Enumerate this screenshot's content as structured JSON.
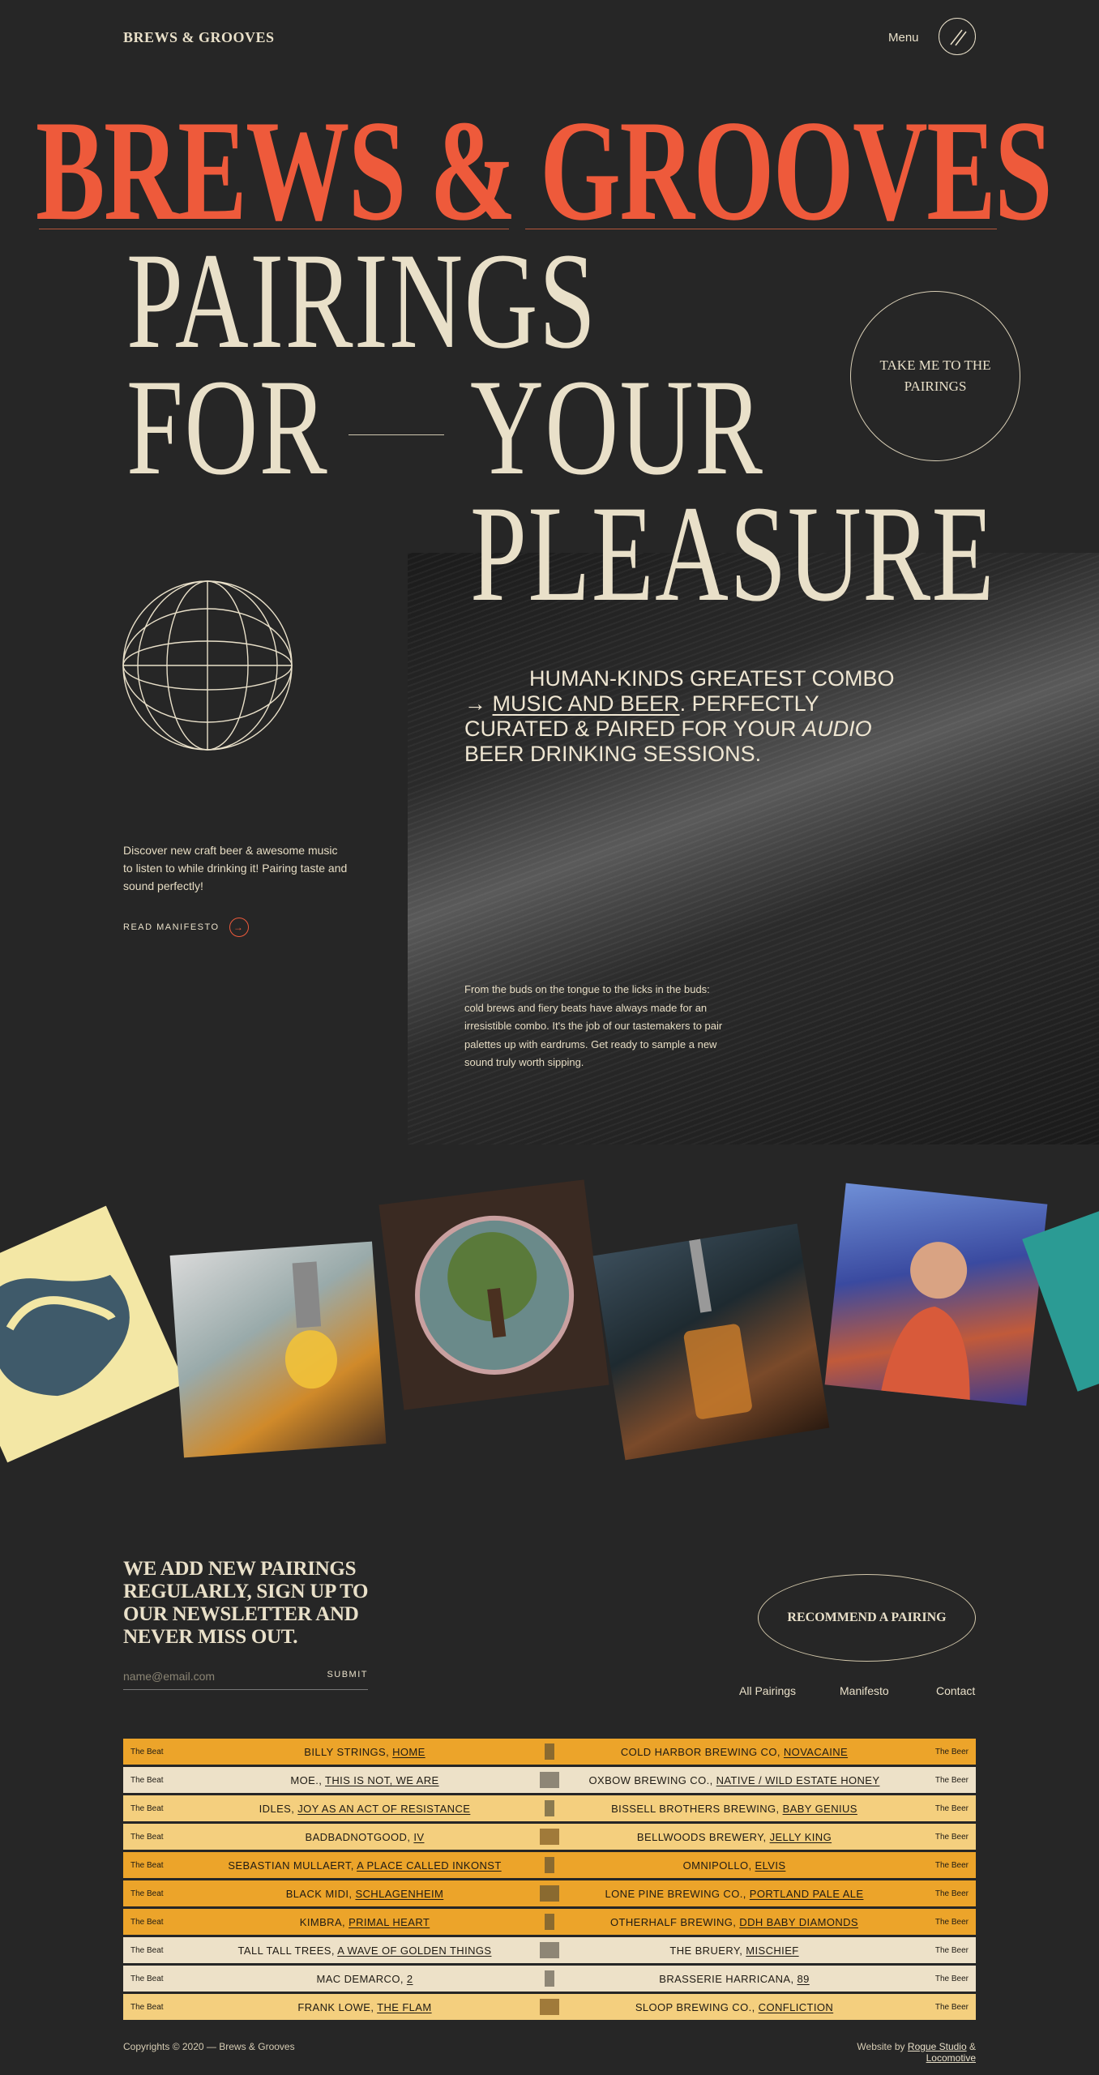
{
  "header": {
    "brand": "BREWS & GROOVES",
    "menu_label": "Menu"
  },
  "hero": {
    "title": "BREWS & GROOVES",
    "line1": "PAIRINGS",
    "line2a": "FOR",
    "line2b": "YOUR",
    "line3": "PLEASURE",
    "cta_circle": "TAKE ME TO THE PAIRINGS"
  },
  "intro": {
    "description": "Discover new craft beer & awesome music to listen to while drinking it! Pairing taste and sound perfectly!",
    "manifesto_link": "READ MANIFESTO"
  },
  "tagline": {
    "part1": "HUMAN-KINDS GREATEST COMBO →",
    "link": "MUSIC AND BEER",
    "part2": ".",
    "part3": "PERFECTLY CURATED & PAIRED FOR YOUR",
    "italic": "AUDIO",
    "part4": "BEER DRINKING SESSIONS."
  },
  "panel_text": "From the buds on the tongue to the licks in the buds: cold brews and fiery beats have always made for an irresistible combo. It's the job of our tastemakers to pair palettes up with eardrums. Get ready to sample a new sound truly worth sipping.",
  "newsletter": {
    "heading": "WE ADD NEW PAIRINGS REGULARLY, SIGN UP TO OUR NEWSLETTER AND NEVER MISS OUT.",
    "placeholder": "name@email.com",
    "submit": "SUBMIT",
    "recommend": "RECOMMEND A PAIRING"
  },
  "nav": {
    "all": "All Pairings",
    "manifesto": "Manifesto",
    "contact": "Contact"
  },
  "pairings": [
    {
      "beat_label": "The Beat",
      "artist": "BILLY STRINGS,",
      "album": "HOME",
      "beer_label": "The Beer",
      "brewery": "COLD HARBOR BREWING CO,",
      "beer": "NOVACAINE",
      "color": "#eca42a"
    },
    {
      "beat_label": "The Beat",
      "artist": "MOE.,",
      "album": "THIS IS NOT, WE ARE",
      "beer_label": "The Beer",
      "brewery": "OXBOW BREWING CO.,",
      "beer": "NATIVE / WILD ESTATE HONEY",
      "color": "#ede1c8"
    },
    {
      "beat_label": "The Beat",
      "artist": "IDLES,",
      "album": "JOY AS AN ACT OF RESISTANCE",
      "beer_label": "The Beer",
      "brewery": "BISSELL BROTHERS BREWING,",
      "beer": "BABY GENIUS",
      "color": "#f4cf7e"
    },
    {
      "beat_label": "The Beat",
      "artist": "BADBADNOTGOOD,",
      "album": "IV",
      "beer_label": "The Beer",
      "brewery": "BELLWOODS BREWERY,",
      "beer": "JELLY KING",
      "color": "#f4cf7e"
    },
    {
      "beat_label": "The Beat",
      "artist": "SEBASTIAN MULLAERT,",
      "album": "A PLACE CALLED INKONST",
      "beer_label": "The Beer",
      "brewery": "OMNIPOLLO,",
      "beer": "ELVIS",
      "color": "#eca42a"
    },
    {
      "beat_label": "The Beat",
      "artist": "BLACK MIDI,",
      "album": "SCHLAGENHEIM",
      "beer_label": "The Beer",
      "brewery": "LONE PINE BREWING CO.,",
      "beer": "PORTLAND PALE ALE",
      "color": "#eca42a"
    },
    {
      "beat_label": "The Beat",
      "artist": "KIMBRA,",
      "album": "PRIMAL HEART",
      "beer_label": "The Beer",
      "brewery": "OTHERHALF BREWING,",
      "beer": "DDH BABY DIAMONDS",
      "color": "#eca42a"
    },
    {
      "beat_label": "The Beat",
      "artist": "TALL TALL TREES,",
      "album": "A WAVE OF GOLDEN THINGS",
      "beer_label": "The Beer",
      "brewery": "THE BRUERY,",
      "beer": "MISCHIEF",
      "color": "#ede1c8"
    },
    {
      "beat_label": "The Beat",
      "artist": "MAC DEMARCO,",
      "album": "2",
      "beer_label": "The Beer",
      "brewery": "BRASSERIE HARRICANA,",
      "beer": "89",
      "color": "#ede1c8"
    },
    {
      "beat_label": "The Beat",
      "artist": "FRANK LOWE,",
      "album": "THE FLAM",
      "beer_label": "The Beer",
      "brewery": "SLOOP BREWING CO.,",
      "beer": "CONFLICTION",
      "color": "#f4cf7e"
    }
  ],
  "footer": {
    "copyright": "Copyrights © 2020 — Brews & Grooves",
    "credit_prefix": "Website by",
    "studio1": "Rogue Studio",
    "amp": "&",
    "studio2": "Locomotive"
  },
  "colors": {
    "background": "#262626",
    "accent": "#ee5a3b",
    "cream": "#e9e0c9",
    "gold": "#eca42a"
  }
}
